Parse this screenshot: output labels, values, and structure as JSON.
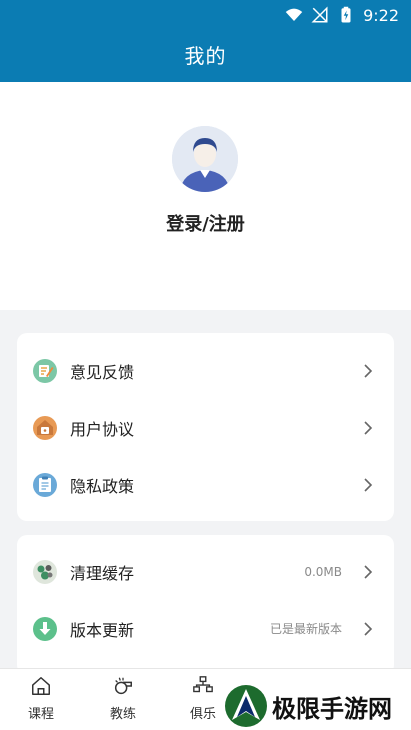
{
  "status_bar": {
    "time": "9:22"
  },
  "header": {
    "title": "我的"
  },
  "profile": {
    "login_label": "登录/注册"
  },
  "menu_group_1": [
    {
      "label": "意见反馈",
      "icon": "feedback-icon"
    },
    {
      "label": "用户协议",
      "icon": "agreement-icon"
    },
    {
      "label": "隐私政策",
      "icon": "privacy-icon"
    }
  ],
  "menu_group_2": [
    {
      "label": "清理缓存",
      "value": "0.0MB",
      "icon": "clear-cache-icon"
    },
    {
      "label": "版本更新",
      "value": "已是最新版本",
      "icon": "update-icon"
    }
  ],
  "tabbar": [
    {
      "label": "课程",
      "icon": "home-icon"
    },
    {
      "label": "教练",
      "icon": "whistle-icon"
    },
    {
      "label": "俱乐",
      "icon": "club-icon"
    }
  ],
  "watermark": {
    "text": "极限手游网"
  },
  "colors": {
    "brand": "#0b7cb3",
    "background": "#f2f3f5"
  }
}
